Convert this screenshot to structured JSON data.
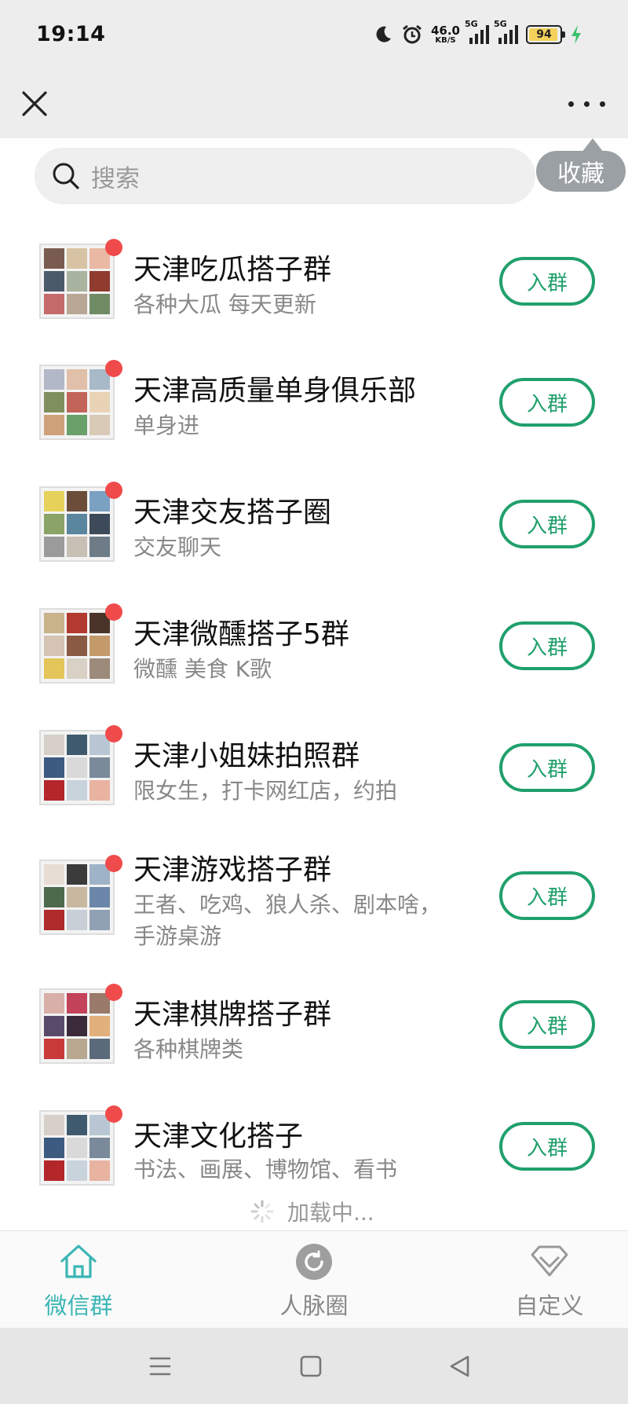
{
  "status_bar": {
    "time": "19:14",
    "net_speed_value": "46.0",
    "net_speed_unit": "KB/S",
    "sim1_label": "5G",
    "sim2_label": "5G",
    "battery": "94",
    "battery_level": 0.94
  },
  "header": {
    "close_icon": "close-icon",
    "more_icon": "more-dots-icon"
  },
  "tooltip": {
    "label": "收藏"
  },
  "search": {
    "placeholder": "搜索"
  },
  "groups": [
    {
      "name": "天津吃瓜搭子群",
      "desc": "各种大瓜 每天更新",
      "button": "入群"
    },
    {
      "name": "天津高质量单身俱乐部",
      "desc": "单身进",
      "button": "入群"
    },
    {
      "name": "天津交友搭子圈",
      "desc": "交友聊天",
      "button": "入群"
    },
    {
      "name": "天津微醺搭子5群",
      "desc": "微醺 美食 K歌",
      "button": "入群"
    },
    {
      "name": "天津小姐妹拍照群",
      "desc": "限女生，打卡网红店，约拍",
      "button": "入群"
    },
    {
      "name": "天津游戏搭子群",
      "desc": "王者、吃鸡、狼人杀、剧本啥，手游桌游",
      "button": "入群"
    },
    {
      "name": "天津棋牌搭子群",
      "desc": "各种棋牌类",
      "button": "入群"
    },
    {
      "name": "天津文化搭子",
      "desc": "书法、画展、博物馆、看书",
      "button": "入群"
    }
  ],
  "loading": {
    "text": "加载中..."
  },
  "tabs": [
    {
      "label": "微信群",
      "icon": "house-icon",
      "active": true
    },
    {
      "label": "人脉圈",
      "icon": "circle-refresh-icon",
      "active": false
    },
    {
      "label": "自定义",
      "icon": "diamond-icon",
      "active": false
    }
  ],
  "colors": {
    "accent": "#20a06b",
    "tab_active": "#3bb5b5",
    "badge": "#f04b4b",
    "header_bg": "#ededed"
  }
}
